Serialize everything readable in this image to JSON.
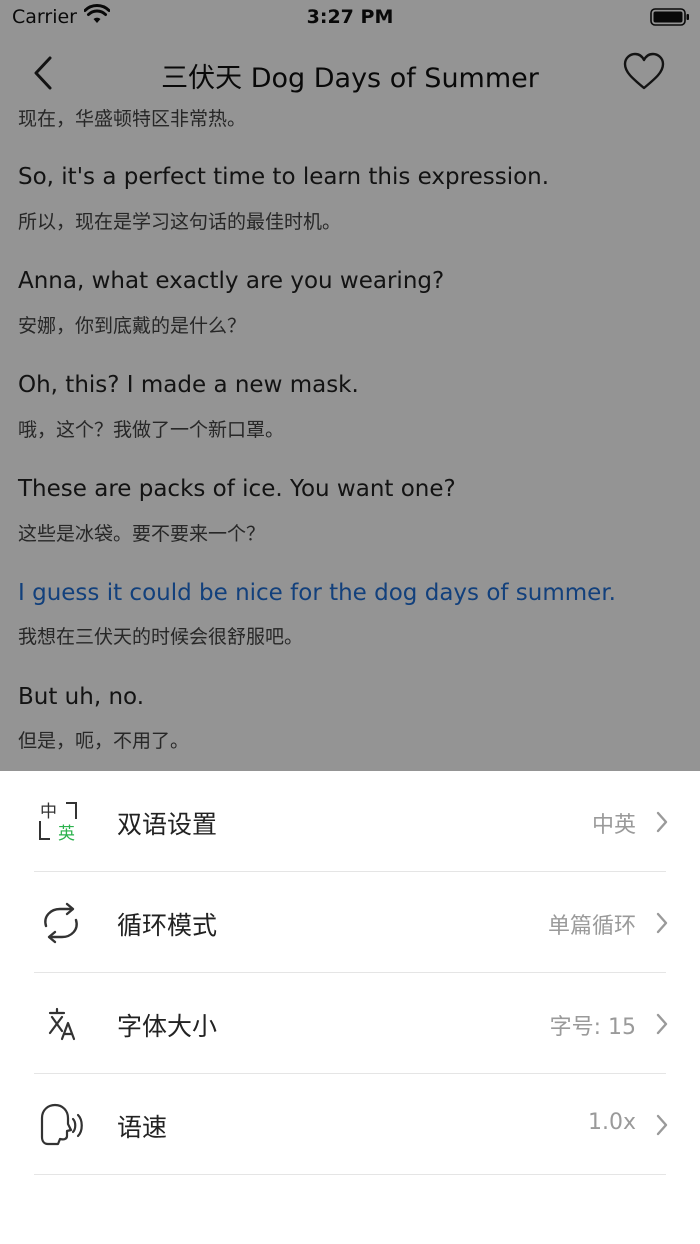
{
  "status_bar": {
    "carrier": "Carrier",
    "time": "3:27 PM"
  },
  "nav": {
    "title": "三伏天 Dog Days of Summer"
  },
  "transcript": [
    {
      "en": "",
      "zh": "现在，华盛顿特区非常热。"
    },
    {
      "en": "So, it's a perfect time to learn this expression.",
      "zh": "所以，现在是学习这句话的最佳时机。"
    },
    {
      "en": "Anna, what exactly are you wearing?",
      "zh": "安娜，你到底戴的是什么？"
    },
    {
      "en": "Oh, this? I made a new mask.",
      "zh": "哦，这个？我做了一个新口罩。"
    },
    {
      "en": "These are packs of ice. You want one?",
      "zh": "这些是冰袋。要不要来一个？"
    },
    {
      "en": "I guess it could be nice for the dog days of summer.",
      "zh": "我想在三伏天的时候会很舒服吧。",
      "active": true
    },
    {
      "en": "But uh, no.",
      "zh": "但是，呃，不用了。"
    }
  ],
  "settings": [
    {
      "icon": "bilingual-icon",
      "label": "双语设置",
      "value": "中英",
      "icon_top": "中",
      "icon_bottom": "英"
    },
    {
      "icon": "loop-icon",
      "label": "循环模式",
      "value": "单篇循环"
    },
    {
      "icon": "font-size-icon",
      "label": "字体大小",
      "value": "字号: 15"
    },
    {
      "icon": "speech-speed-icon",
      "label": "语速",
      "value": "1.0x"
    }
  ],
  "colors": {
    "accent": "#1f6fd6",
    "icon_green": "#2bb24c",
    "overlay": "rgba(0,0,0,0.42)"
  }
}
